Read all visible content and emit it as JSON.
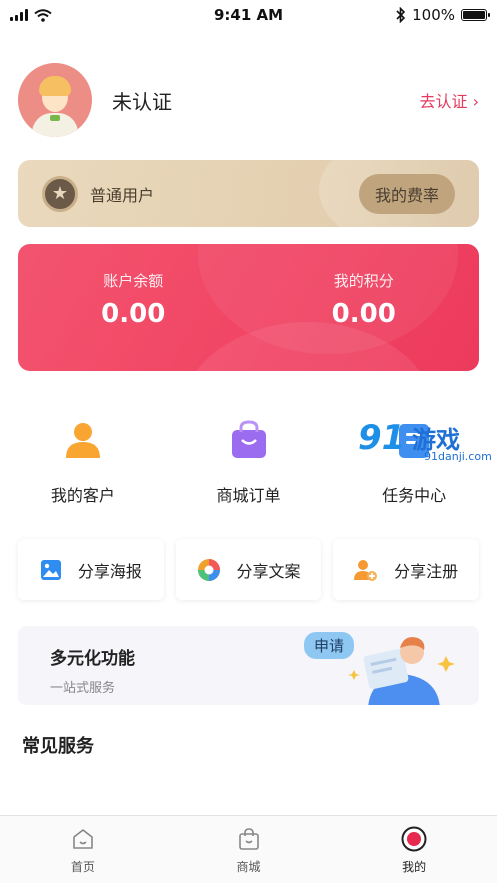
{
  "status_bar": {
    "time": "9:41 AM",
    "battery": "100%"
  },
  "profile": {
    "name": "未认证",
    "certify_link": "去认证 ›"
  },
  "member_card": {
    "level": "普通用户",
    "rate_button": "我的费率"
  },
  "balance_card": {
    "account_balance_label": "账户余额",
    "account_balance_value": "0.00",
    "points_label": "我的积分",
    "points_value": "0.00"
  },
  "quick_menu": {
    "items": [
      {
        "label": "我的客户",
        "icon": "user-icon",
        "color": "#f8a531"
      },
      {
        "label": "商城订单",
        "icon": "shopping-bag-icon",
        "color": "#9c6cf0"
      },
      {
        "label": "任务中心",
        "icon": "task-icon",
        "color": "#3f8ff0"
      }
    ]
  },
  "watermark": {
    "mark": "91",
    "text": "游戏",
    "url": "91danji.com"
  },
  "share": {
    "items": [
      {
        "label": "分享海报",
        "icon": "image-icon",
        "color": "#2f8cf0"
      },
      {
        "label": "分享文案",
        "icon": "aperture-icon",
        "color": "#f0a12b"
      },
      {
        "label": "分享注册",
        "icon": "add-user-icon",
        "color": "#f59a33"
      }
    ]
  },
  "feature_banner": {
    "title": "多元化功能",
    "subtitle": "一站式服务",
    "bubble": "申请"
  },
  "services": {
    "title": "常见服务"
  },
  "tab_bar": {
    "tabs": [
      {
        "label": "首页",
        "icon": "home-icon"
      },
      {
        "label": "商城",
        "icon": "shop-icon"
      },
      {
        "label": "我的",
        "icon": "profile-dot-icon",
        "active_color": "#e6294e"
      }
    ]
  }
}
